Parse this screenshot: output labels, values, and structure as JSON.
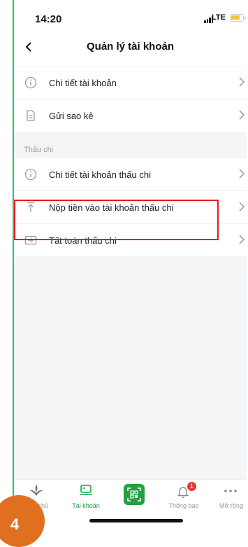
{
  "status_bar": {
    "time": "14:20",
    "network": "LTE"
  },
  "header": {
    "back_symbol": "<",
    "title": "Quản lý tài khoản"
  },
  "account_group": [
    {
      "label": "Chi tiết tài khoản",
      "icon": "info-circle-icon"
    },
    {
      "label": "Gửi sao kê",
      "icon": "document-icon"
    }
  ],
  "overdraft_section": {
    "title": "Thấu chi",
    "items": [
      {
        "label": "Chi tiết tài khoản thấu chi",
        "icon": "info-circle-icon"
      },
      {
        "label": "Nộp tiền vào tài khoản thấu chi",
        "icon": "upload-arrow-icon"
      },
      {
        "label": "Tất toán thấu chi",
        "icon": "settle-arrow-icon"
      }
    ]
  },
  "tabbar": {
    "items": [
      {
        "label": "ang chủ",
        "icon": "home-logo-icon"
      },
      {
        "label": "Tài khoản",
        "icon": "card-icon",
        "active": true
      },
      {
        "label": "",
        "icon": "qr-scan-icon"
      },
      {
        "label": "Thông báo",
        "icon": "bell-icon",
        "badge": "1"
      },
      {
        "label": "Mở rộng",
        "icon": "more-dots-icon"
      }
    ]
  },
  "annotation": {
    "step": "4"
  },
  "colors": {
    "accent": "#16a34a",
    "highlight": "#e11d1d",
    "badge": "#e53935",
    "step": "#e0701f"
  }
}
